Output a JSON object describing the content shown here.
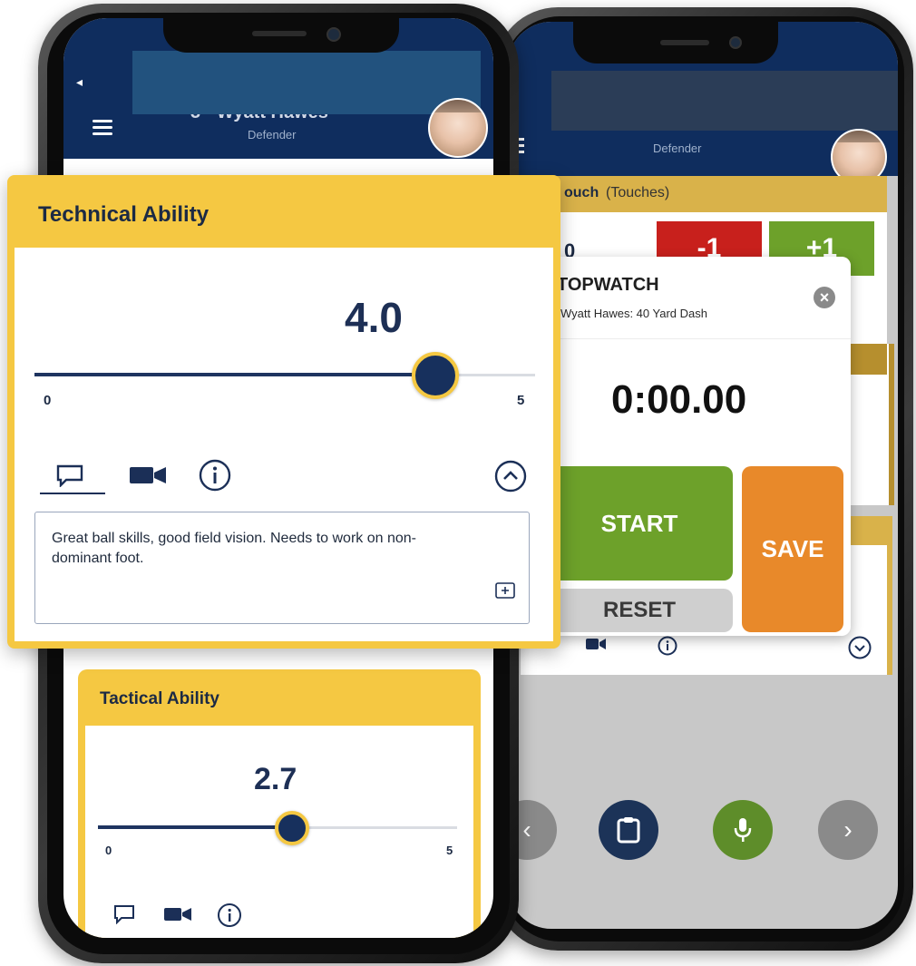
{
  "front_phone": {
    "header": {
      "name_fragment": "3 · Wyatt Hawes",
      "role": "Defender"
    },
    "technical_card": {
      "title": "Technical Ability",
      "value_text": "4.0",
      "value": 4.0,
      "min_label": "0",
      "max_label": "5",
      "min": 0,
      "max": 5,
      "note": "Great ball skills, good field vision. Needs to work on non-dominant foot."
    },
    "tactical_card": {
      "title": "Tactical Ability",
      "value_text": "2.7",
      "value": 2.7,
      "min_label": "0",
      "max_label": "5",
      "min": 0,
      "max": 5
    }
  },
  "back_phone": {
    "header": {
      "role": "Defender"
    },
    "touch_card": {
      "title": "ouch",
      "subtitle": "(Touches)",
      "count_fragment": "0",
      "minus_label": "-1",
      "plus_label": "+1"
    },
    "stopwatch": {
      "title": "TOPWATCH",
      "subtitle": "Wyatt Hawes: 40 Yard Dash",
      "time": "0:00.00",
      "start_label": "START",
      "reset_label": "RESET",
      "save_label": "SAVE"
    },
    "bottom_nav": {
      "prev_glyph": "‹",
      "next_glyph": "›"
    }
  },
  "colors": {
    "navy": "#0f2d5e",
    "yellow": "#f5c842",
    "green": "#6da12a",
    "orange": "#e8892a",
    "red": "#c8201c",
    "reset_gray": "#cfcfcf"
  }
}
